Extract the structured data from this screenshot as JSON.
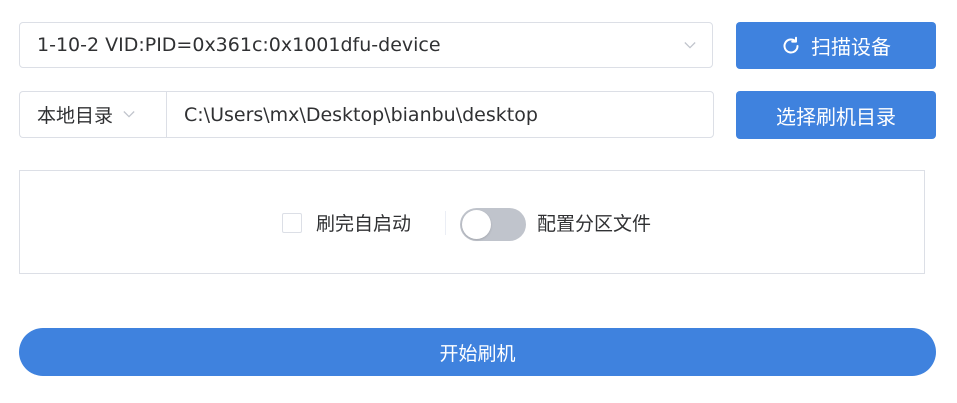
{
  "colors": {
    "primary": "#3f82de",
    "border": "#dcdfe6",
    "text": "#303133",
    "switch_off": "#c0c4cc"
  },
  "device": {
    "selected": "1-10-2 VID:PID=0x361c:0x1001dfu-device",
    "icon": "chevron-down-icon"
  },
  "scan": {
    "label": "扫描设备",
    "icon": "refresh-icon"
  },
  "source": {
    "selected": "本地目录",
    "icon": "chevron-down-icon"
  },
  "path": {
    "value": "C:\\Users\\mx\\Desktop\\bianbu\\desktop"
  },
  "choose_dir": {
    "label": "选择刷机目录"
  },
  "options": {
    "auto_reboot": {
      "label": "刷完自启动",
      "checked": false
    },
    "partition_config": {
      "label": "配置分区文件",
      "enabled": false
    }
  },
  "start": {
    "label": "开始刷机"
  }
}
